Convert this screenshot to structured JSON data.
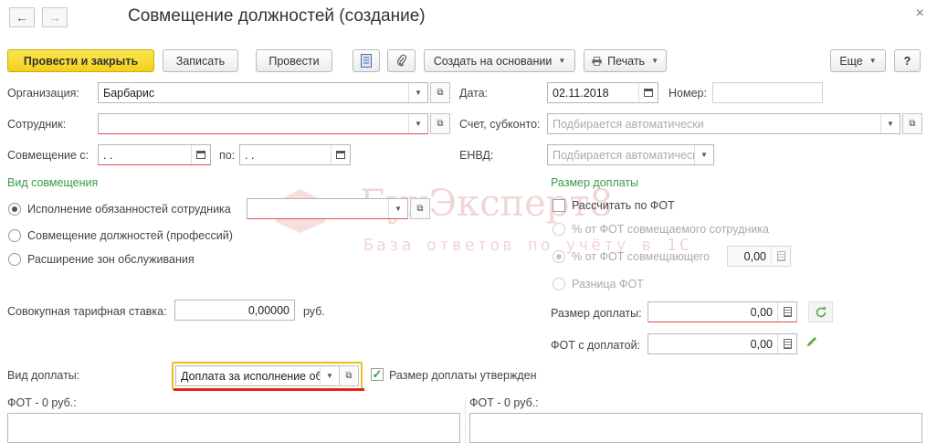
{
  "window": {
    "title": "Совмещение должностей (создание)",
    "close_glyph": "×"
  },
  "nav": {
    "back": "←",
    "forward": "→"
  },
  "toolbar": {
    "post_close": "Провести и закрыть",
    "write": "Записать",
    "post": "Провести",
    "create_based": "Создать на основании",
    "print": "Печать",
    "more": "Еще",
    "help": "?"
  },
  "header": {
    "org_label": "Организация:",
    "org_value": "Барбарис",
    "date_label": "Дата:",
    "date_value": "02.11.2018",
    "number_label": "Номер:",
    "number_value": "",
    "employee_label": "Сотрудник:",
    "employee_value": "",
    "account_label": "Счет, субконто:",
    "account_placeholder": "Подбирается автоматически",
    "combo_from_label": "Совмещение с:",
    "combo_from_value": " .  .",
    "combo_to_label": "по:",
    "combo_to_value": " .  .",
    "envd_label": "ЕНВД:",
    "envd_placeholder": "Подбирается автоматически"
  },
  "combo_type": {
    "section": "Вид совмещения",
    "options": [
      "Исполнение обязанностей сотрудника",
      "Совмещение должностей (профессий)",
      "Расширение зон обслуживания"
    ],
    "selected_index": 0
  },
  "surcharge": {
    "section": "Размер доплаты",
    "calc_fot": "Рассчитать по ФОТ",
    "opt_pct_replaced": "% от ФОТ совмещаемого сотрудника",
    "opt_pct_combining": "% от ФОТ совмещающего",
    "pct_value": "0,00",
    "opt_diff": "Разница ФОТ",
    "amount_label": "Размер доплаты:",
    "amount_value": "0,00",
    "fot_with_label": "ФОТ с доплатой:",
    "fot_with_value": "0,00"
  },
  "tariff": {
    "label": "Совокупная тарифная ставка:",
    "value": "0,00000",
    "unit": "руб."
  },
  "payment": {
    "label": "Вид доплаты:",
    "value": "Доплата за исполнение обяза",
    "approved_label": "Размер доплаты утвержден"
  },
  "fot": {
    "left": "ФОТ  - 0 руб.:",
    "right": "ФОТ  - 0 руб.:"
  },
  "watermark": {
    "title": "БухЭксперт8",
    "subtitle": "База ответов по учёту в 1С"
  },
  "colors": {
    "primary_button": "#f3d01c",
    "section_green": "#3a9a48",
    "highlight": "#e8c21a",
    "underline_red": "#e3241b"
  }
}
